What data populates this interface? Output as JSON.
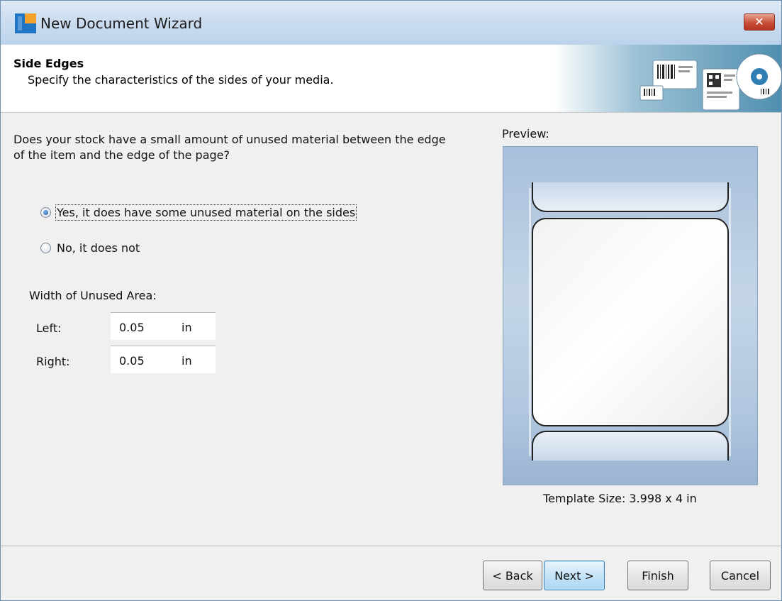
{
  "window": {
    "title": "New Document Wizard",
    "close_label": "✕"
  },
  "header": {
    "title": "Side Edges",
    "subtitle": "Specify the characteristics of the sides of your media."
  },
  "question": "Does your stock have a small amount of unused material between the edge of the item and the edge of the page?",
  "options": [
    {
      "text": "Yes, it does have some unused material on the sides",
      "mnemonic": "Y",
      "selected": true
    },
    {
      "text": "No, it does not",
      "mnemonic": "o",
      "selected": false
    }
  ],
  "unused_area": {
    "label": "Width of Unused Area:",
    "left": {
      "label": "Left:",
      "value": "0.05",
      "unit": "in"
    },
    "right": {
      "label": "Right:",
      "value": "0.05",
      "unit": "in"
    }
  },
  "preview": {
    "label": "Preview:",
    "template_size": "Template Size:  3.998 x 4 in"
  },
  "buttons": {
    "back": "< Back",
    "next": "Next >",
    "finish": "Finish",
    "cancel": "Cancel"
  },
  "icons": {
    "app": "document-wizard-icon",
    "close": "close-icon",
    "banner": "barcode-labels-banner-icon"
  }
}
